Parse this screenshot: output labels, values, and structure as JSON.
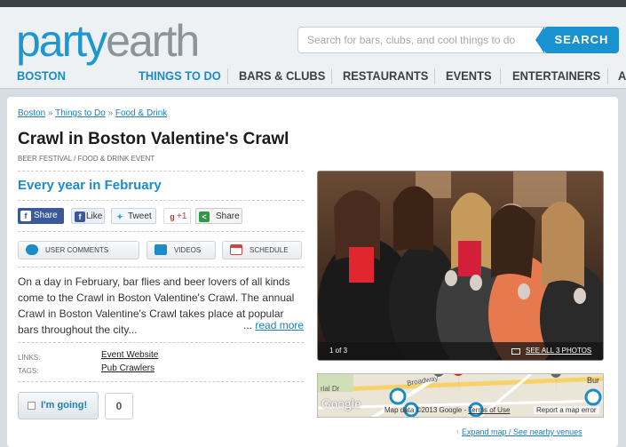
{
  "header": {
    "logo_party": "party",
    "logo_earth": "earth",
    "search_placeholder": "Search for bars, clubs, and cool things to do",
    "search_button": "SEARCH",
    "brand_color": "#1c97cf"
  },
  "nav": {
    "city": "BOSTON",
    "items": [
      "THINGS TO DO",
      "BARS & CLUBS",
      "RESTAURANTS",
      "EVENTS",
      "ENTERTAINERS",
      "A"
    ]
  },
  "breadcrumb": {
    "items": [
      "Boston",
      "Things to Do",
      "Food & Drink"
    ],
    "separator": "»"
  },
  "event": {
    "title": "Crawl in Boston Valentine's Crawl",
    "category": "BEER FESTIVAL / FOOD & DRINK EVENT",
    "when": "Every year in February",
    "description": "On a day in February, bar flies and beer lovers of all kinds come to the Crawl in Boston Valentine's Crawl. The annual Crawl in Boston Valentine's Crawl takes place at popular bars throughout the city...",
    "read_more_prefix": "...",
    "read_more": "read more"
  },
  "share": {
    "facebook": "Share",
    "like": "Like",
    "tweet": "Tweet",
    "gplus": "+1",
    "share": "Share"
  },
  "tabs": {
    "comments": "USER COMMENTS",
    "videos": "VIDEOS",
    "schedule": "SCHEDULE"
  },
  "meta": {
    "links_label": "LINKS:",
    "links_value": "Event Website",
    "tags_label": "TAGS:",
    "tags_value": "Pub Crawlers"
  },
  "going": {
    "label": "I'm going!",
    "count": "0"
  },
  "photo": {
    "counter": "1 of 3",
    "see_all": "SEE ALL 3 PHOTOS"
  },
  "map": {
    "street1": "Broadway",
    "street2": "rial Dr",
    "copyright": "Map data ©2013 Google",
    "terms": "Terms of Use",
    "report": "Report a map error",
    "google": "Google",
    "corner": "Bur",
    "expand": "Expand map / See nearby venues"
  }
}
